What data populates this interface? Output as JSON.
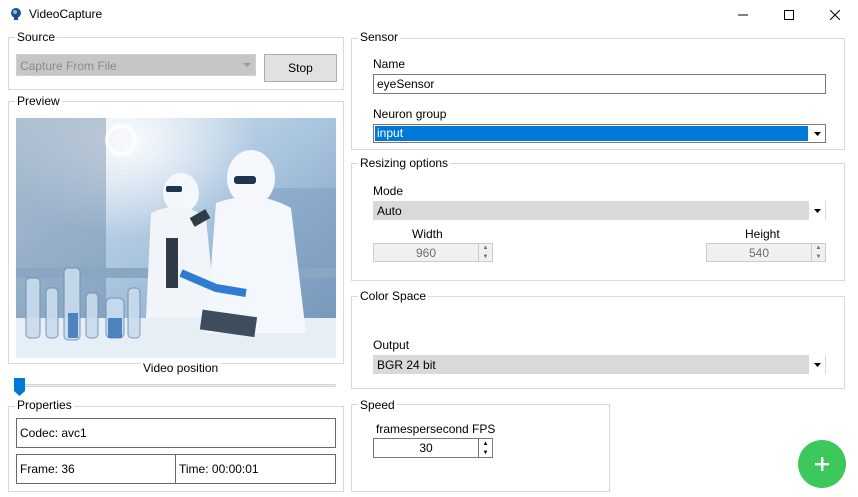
{
  "window": {
    "title": "VideoCapture"
  },
  "source": {
    "group_label": "Source",
    "selected": "Capture From File",
    "stop_label": "Stop"
  },
  "preview": {
    "group_label": "Preview",
    "slider_label": "Video position",
    "slider_position": 0.0
  },
  "properties": {
    "group_label": "Properties",
    "codec": "Codec: avc1",
    "frame": "Frame: 36",
    "time": "Time: 00:00:01"
  },
  "sensor": {
    "group_label": "Sensor",
    "name_label": "Name",
    "name_value": "eyeSensor",
    "neuron_group_label": "Neuron group",
    "neuron_group_value": "input"
  },
  "resizing": {
    "group_label": "Resizing options",
    "mode_label": "Mode",
    "mode_value": "Auto",
    "width_label": "Width",
    "width_value": "960",
    "height_label": "Height",
    "height_value": "540"
  },
  "color_space": {
    "group_label": "Color Space",
    "output_label": "Output",
    "output_value": "BGR 24 bit"
  },
  "speed": {
    "group_label": "Speed",
    "fps_label": "framespersecond FPS",
    "fps_value": "30"
  },
  "fab": {
    "icon": "plus-icon",
    "color": "#3cc85a"
  },
  "colors": {
    "selection": "#0078d7",
    "slider_thumb": "#0078d7"
  }
}
